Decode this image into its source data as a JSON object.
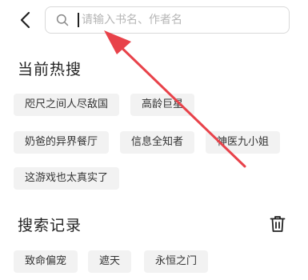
{
  "header": {
    "back_icon": "chevron-left-icon",
    "search": {
      "icon": "search-icon",
      "placeholder": "请输入书名、作者名",
      "value": ""
    }
  },
  "hot_search": {
    "title": "当前热搜",
    "tags": [
      "咫尺之间人尽敌国",
      "高龄巨星",
      "奶爸的异界餐厅",
      "信息全知者",
      "神医九小姐",
      "这游戏也太真实了"
    ]
  },
  "history": {
    "title": "搜索记录",
    "clear_icon": "trash-icon",
    "tags": [
      "致命偏宠",
      "遮天",
      "永恒之门"
    ]
  },
  "annotation": {
    "arrow_icon": "red-arrow-icon",
    "color": "#e8424a"
  }
}
